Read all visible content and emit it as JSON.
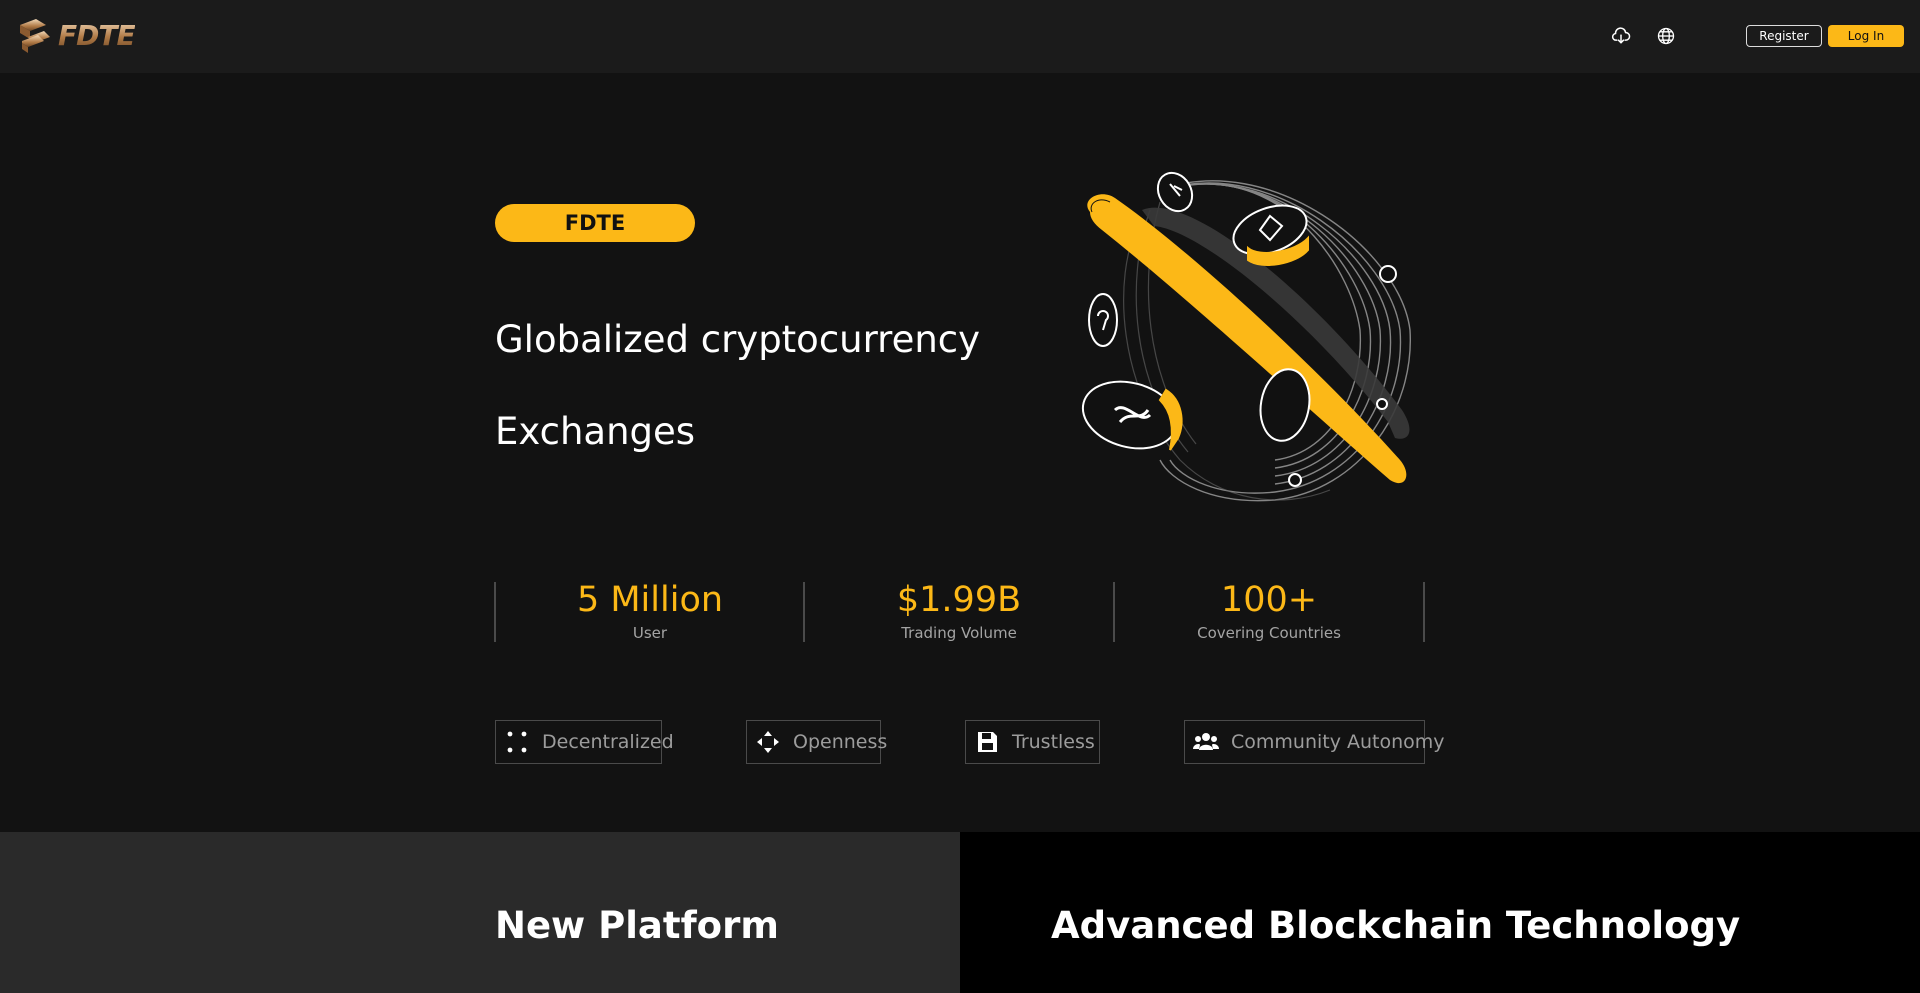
{
  "header": {
    "logo_text": "FDTE",
    "download_icon": "cloud-download-icon",
    "language_icon": "globe-icon",
    "register_label": "Register",
    "login_label": "Log In"
  },
  "hero": {
    "badge": "FDTE",
    "headline_line1": "Globalized cryptocurrency",
    "headline_line2": "Exchanges",
    "illustration": "crypto-globe-illustration"
  },
  "stats": [
    {
      "value": "5 Million",
      "label": "User"
    },
    {
      "value": "$1.99B",
      "label": "Trading Volume"
    },
    {
      "value": "100+",
      "label": "Covering Countries"
    }
  ],
  "features": [
    {
      "label": "Decentralized",
      "icon": "decentralized-dots-icon"
    },
    {
      "label": "Openness",
      "icon": "openness-arrows-icon"
    },
    {
      "label": "Trustless",
      "icon": "save-disk-icon"
    },
    {
      "label": "Community Autonomy",
      "icon": "users-group-icon"
    }
  ],
  "panels": {
    "left_title": "New Platform",
    "right_title": "Advanced Blockchain Technology"
  },
  "colors": {
    "accent": "#fcb817",
    "background": "#121212",
    "header_bg": "#1b1b1b",
    "panel_left_bg": "#2a2a2a",
    "panel_right_bg": "#000000",
    "muted_text": "#a4a4a4"
  }
}
